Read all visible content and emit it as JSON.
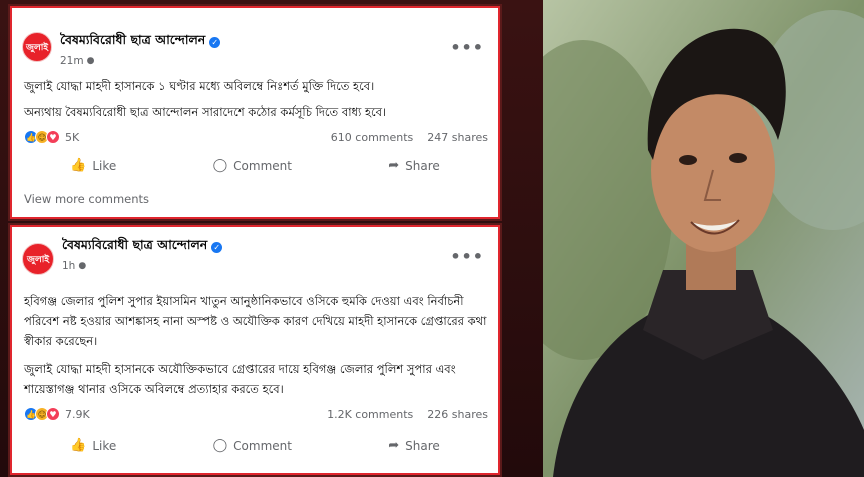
{
  "posts": [
    {
      "page_name": "বৈষম্যবিরোধী ছাত্র আন্দোলন",
      "avatar_text": "জুলাই",
      "time": "21m",
      "paragraphs": [
        "জুলাই যোদ্ধা মাহদী হাসানকে ১ ঘণ্টার মধ্যে অবিলম্বে নিঃশর্ত মুক্তি দিতে হবে।",
        "অন্যথায় বৈষম্যবিরোধী ছাত্র আন্দোলন সারাদেশে কঠোর কর্মসূচি দিতে বাধ্য হবে।"
      ],
      "reactions_count": "5K",
      "comments": "610 comments",
      "shares": "247 shares",
      "like_label": "Like",
      "comment_label": "Comment",
      "share_label": "Share",
      "view_more": "View more comments"
    },
    {
      "page_name": "বৈষম্যবিরোধী ছাত্র আন্দোলন",
      "avatar_text": "জুলাই",
      "time": "1h",
      "paragraphs": [
        "হবিগঞ্জ জেলার পুলিশ সুপার ইয়াসমিন খাতুন আনুষ্ঠানিকভাবে ওসিকে হুমকি দেওয়া এবং নির্বাচনী পরিবেশ নষ্ট হওয়ার আশঙ্কাসহ নানা অস্পষ্ট ও অযৌক্তিক কারণ দেখিয়ে মাহদী হাসানকে গ্রেপ্তারের কথা স্বীকার করেছেন।",
        "জুলাই যোদ্ধা মাহদী হাসানকে অযৌক্তিকভাবে গ্রেপ্তারের দায়ে হবিগঞ্জ জেলার পুলিশ সুপার এবং শায়েস্তাগঞ্জ থানার ওসিকে অবিলম্বে প্রত্যাহার করতে হবে।"
      ],
      "reactions_count": "7.9K",
      "comments": "1.2K comments",
      "shares": "226 shares",
      "like_label": "Like",
      "comment_label": "Comment",
      "share_label": "Share"
    }
  ],
  "icons": {
    "verified": "✓",
    "globe": "🌐",
    "more": "•••",
    "like": "👍",
    "comment": "◯",
    "share": "➦"
  },
  "colors": {
    "accent_border": "#e0262e",
    "facebook_blue": "#1877f2",
    "avatar_red": "#e8222a"
  }
}
